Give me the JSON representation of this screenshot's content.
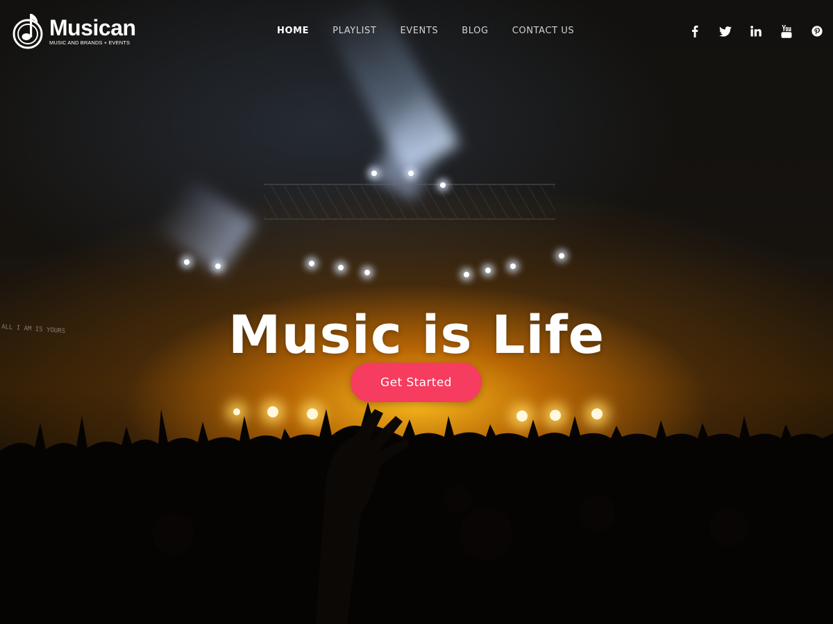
{
  "brand": {
    "name": "Musican",
    "tagline": "MUSIC AND BRANDS + EVENTS"
  },
  "nav": {
    "items": [
      {
        "label": "HOME",
        "active": true
      },
      {
        "label": "PLAYLIST",
        "active": false
      },
      {
        "label": "EVENTS",
        "active": false
      },
      {
        "label": "BLOG",
        "active": false
      },
      {
        "label": "CONTACT US",
        "active": false
      }
    ]
  },
  "social": {
    "icons": [
      "facebook-icon",
      "twitter-icon",
      "linkedin-icon",
      "youtube-icon",
      "pinterest-icon"
    ]
  },
  "hero": {
    "headline": "Music is Life",
    "cta_label": "Get Started",
    "stage_screen_text_left": "ALL I AM IS YOURS"
  },
  "colors": {
    "accent": "#f63c5f",
    "text": "#ffffff",
    "background": "#0b0906"
  }
}
